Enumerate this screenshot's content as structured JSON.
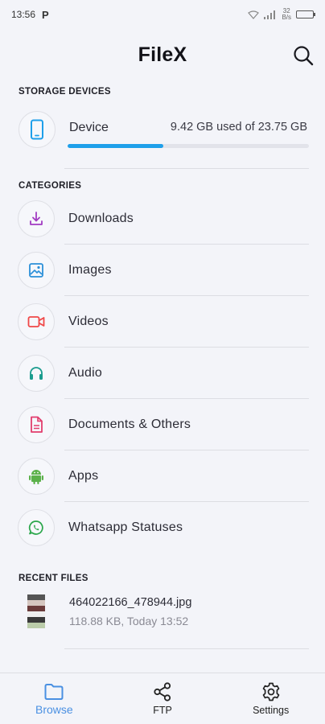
{
  "status_bar": {
    "time": "13:56",
    "app_icon": "P",
    "speed_top": "32",
    "speed_bottom": "B/s",
    "battery_label": "battery-icon"
  },
  "header": {
    "title": "FileX",
    "search_icon": "search-icon"
  },
  "storage": {
    "section_title": "STORAGE DEVICES",
    "device": {
      "label": "Device",
      "usage": "9.42 GB used of 23.75 GB",
      "used_fraction": 0.397,
      "icon": "phone-icon"
    }
  },
  "categories": {
    "section_title": "CATEGORIES",
    "items": [
      {
        "label": "Downloads",
        "icon": "download-icon",
        "color": "#a23bc2"
      },
      {
        "label": "Images",
        "icon": "image-icon",
        "color": "#2b8fd8"
      },
      {
        "label": "Videos",
        "icon": "video-icon",
        "color": "#f04848"
      },
      {
        "label": "Audio",
        "icon": "headphones-icon",
        "color": "#1a9c8e"
      },
      {
        "label": "Documents & Others",
        "icon": "document-icon",
        "color": "#e23d6d"
      },
      {
        "label": "Apps",
        "icon": "android-icon",
        "color": "#5bb14a"
      },
      {
        "label": "Whatsapp Statuses",
        "icon": "whatsapp-icon",
        "color": "#2aa64a"
      }
    ]
  },
  "recent": {
    "section_title": "RECENT FILES",
    "files": [
      {
        "name": "464022166_478944.jpg",
        "meta": "118.88 KB, Today 13:52"
      }
    ]
  },
  "bottom_nav": {
    "items": [
      {
        "label": "Browse",
        "icon": "folder-icon",
        "active": true
      },
      {
        "label": "FTP",
        "icon": "share-icon",
        "active": false
      },
      {
        "label": "Settings",
        "icon": "gear-icon",
        "active": false
      }
    ],
    "active_color": "#4a90e2"
  }
}
